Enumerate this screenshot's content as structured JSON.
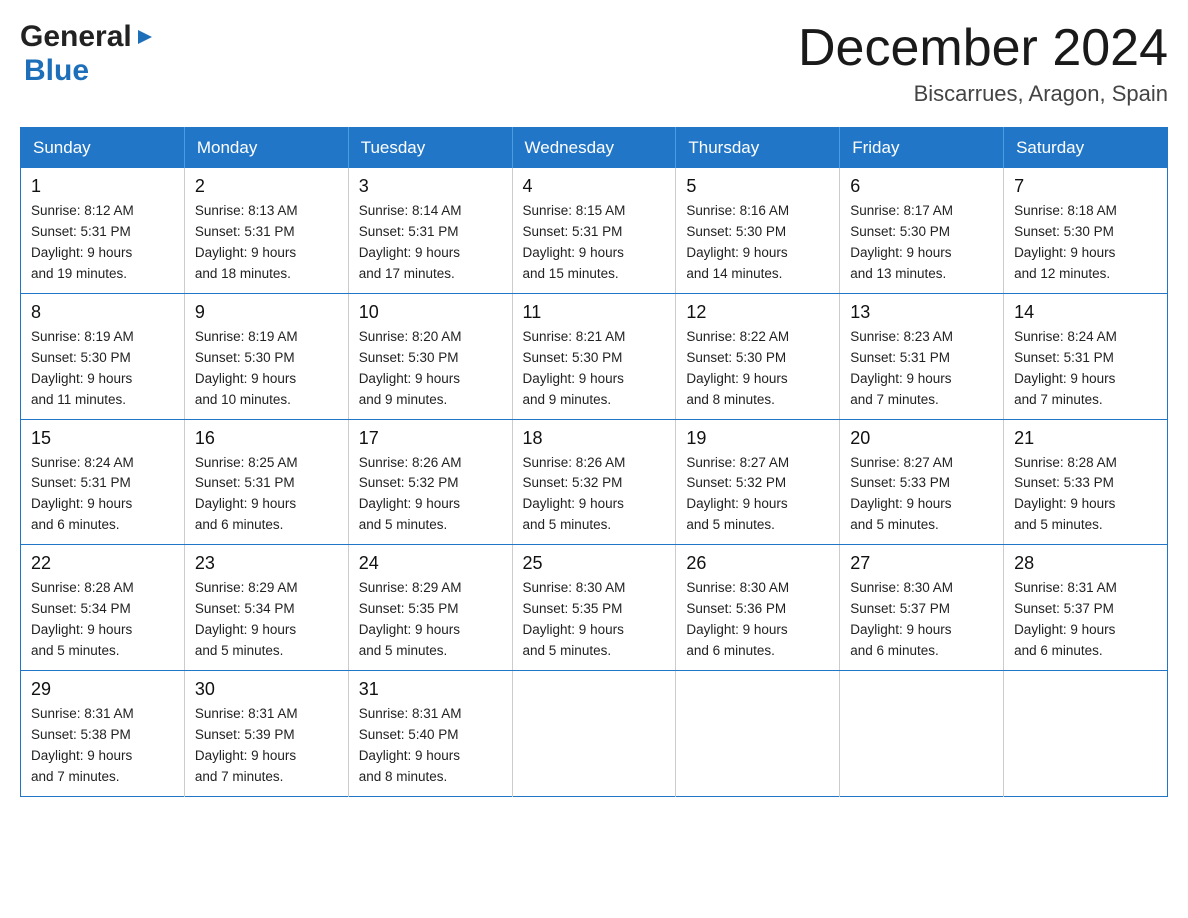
{
  "header": {
    "logo_general": "General",
    "logo_blue": "Blue",
    "month_title": "December 2024",
    "location": "Biscarrues, Aragon, Spain"
  },
  "days_of_week": [
    "Sunday",
    "Monday",
    "Tuesday",
    "Wednesday",
    "Thursday",
    "Friday",
    "Saturday"
  ],
  "weeks": [
    [
      {
        "day": "1",
        "sunrise": "8:12 AM",
        "sunset": "5:31 PM",
        "daylight": "9 hours and 19 minutes."
      },
      {
        "day": "2",
        "sunrise": "8:13 AM",
        "sunset": "5:31 PM",
        "daylight": "9 hours and 18 minutes."
      },
      {
        "day": "3",
        "sunrise": "8:14 AM",
        "sunset": "5:31 PM",
        "daylight": "9 hours and 17 minutes."
      },
      {
        "day": "4",
        "sunrise": "8:15 AM",
        "sunset": "5:31 PM",
        "daylight": "9 hours and 15 minutes."
      },
      {
        "day": "5",
        "sunrise": "8:16 AM",
        "sunset": "5:30 PM",
        "daylight": "9 hours and 14 minutes."
      },
      {
        "day": "6",
        "sunrise": "8:17 AM",
        "sunset": "5:30 PM",
        "daylight": "9 hours and 13 minutes."
      },
      {
        "day": "7",
        "sunrise": "8:18 AM",
        "sunset": "5:30 PM",
        "daylight": "9 hours and 12 minutes."
      }
    ],
    [
      {
        "day": "8",
        "sunrise": "8:19 AM",
        "sunset": "5:30 PM",
        "daylight": "9 hours and 11 minutes."
      },
      {
        "day": "9",
        "sunrise": "8:19 AM",
        "sunset": "5:30 PM",
        "daylight": "9 hours and 10 minutes."
      },
      {
        "day": "10",
        "sunrise": "8:20 AM",
        "sunset": "5:30 PM",
        "daylight": "9 hours and 9 minutes."
      },
      {
        "day": "11",
        "sunrise": "8:21 AM",
        "sunset": "5:30 PM",
        "daylight": "9 hours and 9 minutes."
      },
      {
        "day": "12",
        "sunrise": "8:22 AM",
        "sunset": "5:30 PM",
        "daylight": "9 hours and 8 minutes."
      },
      {
        "day": "13",
        "sunrise": "8:23 AM",
        "sunset": "5:31 PM",
        "daylight": "9 hours and 7 minutes."
      },
      {
        "day": "14",
        "sunrise": "8:24 AM",
        "sunset": "5:31 PM",
        "daylight": "9 hours and 7 minutes."
      }
    ],
    [
      {
        "day": "15",
        "sunrise": "8:24 AM",
        "sunset": "5:31 PM",
        "daylight": "9 hours and 6 minutes."
      },
      {
        "day": "16",
        "sunrise": "8:25 AM",
        "sunset": "5:31 PM",
        "daylight": "9 hours and 6 minutes."
      },
      {
        "day": "17",
        "sunrise": "8:26 AM",
        "sunset": "5:32 PM",
        "daylight": "9 hours and 5 minutes."
      },
      {
        "day": "18",
        "sunrise": "8:26 AM",
        "sunset": "5:32 PM",
        "daylight": "9 hours and 5 minutes."
      },
      {
        "day": "19",
        "sunrise": "8:27 AM",
        "sunset": "5:32 PM",
        "daylight": "9 hours and 5 minutes."
      },
      {
        "day": "20",
        "sunrise": "8:27 AM",
        "sunset": "5:33 PM",
        "daylight": "9 hours and 5 minutes."
      },
      {
        "day": "21",
        "sunrise": "8:28 AM",
        "sunset": "5:33 PM",
        "daylight": "9 hours and 5 minutes."
      }
    ],
    [
      {
        "day": "22",
        "sunrise": "8:28 AM",
        "sunset": "5:34 PM",
        "daylight": "9 hours and 5 minutes."
      },
      {
        "day": "23",
        "sunrise": "8:29 AM",
        "sunset": "5:34 PM",
        "daylight": "9 hours and 5 minutes."
      },
      {
        "day": "24",
        "sunrise": "8:29 AM",
        "sunset": "5:35 PM",
        "daylight": "9 hours and 5 minutes."
      },
      {
        "day": "25",
        "sunrise": "8:30 AM",
        "sunset": "5:35 PM",
        "daylight": "9 hours and 5 minutes."
      },
      {
        "day": "26",
        "sunrise": "8:30 AM",
        "sunset": "5:36 PM",
        "daylight": "9 hours and 6 minutes."
      },
      {
        "day": "27",
        "sunrise": "8:30 AM",
        "sunset": "5:37 PM",
        "daylight": "9 hours and 6 minutes."
      },
      {
        "day": "28",
        "sunrise": "8:31 AM",
        "sunset": "5:37 PM",
        "daylight": "9 hours and 6 minutes."
      }
    ],
    [
      {
        "day": "29",
        "sunrise": "8:31 AM",
        "sunset": "5:38 PM",
        "daylight": "9 hours and 7 minutes."
      },
      {
        "day": "30",
        "sunrise": "8:31 AM",
        "sunset": "5:39 PM",
        "daylight": "9 hours and 7 minutes."
      },
      {
        "day": "31",
        "sunrise": "8:31 AM",
        "sunset": "5:40 PM",
        "daylight": "9 hours and 8 minutes."
      },
      null,
      null,
      null,
      null
    ]
  ],
  "labels": {
    "sunrise": "Sunrise:",
    "sunset": "Sunset:",
    "daylight": "Daylight:"
  }
}
